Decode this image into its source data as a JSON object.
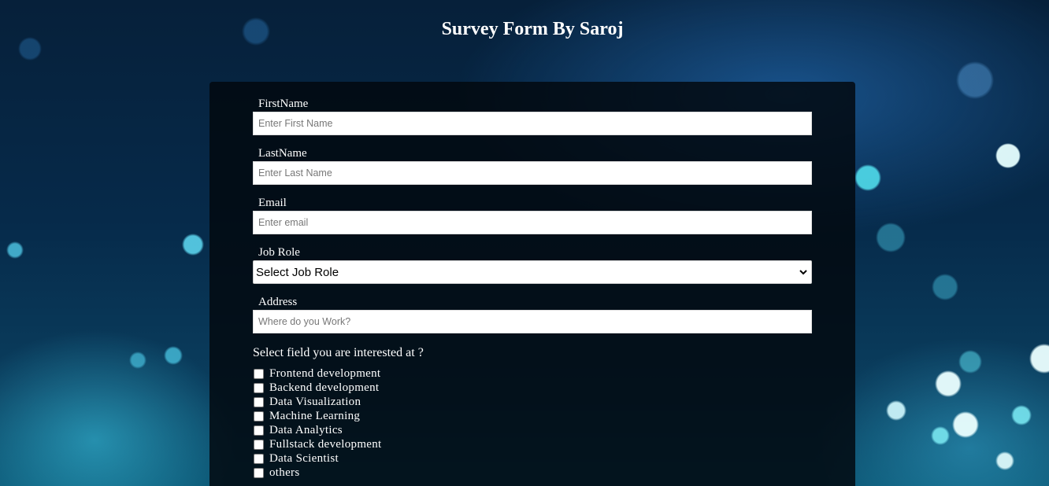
{
  "page": {
    "title": "Survey Form By Saroj"
  },
  "form": {
    "fields": [
      {
        "label": "FirstName",
        "placeholder": "Enter First Name",
        "value": ""
      },
      {
        "label": "LastName",
        "placeholder": "Enter Last Name",
        "value": ""
      },
      {
        "label": "Email",
        "placeholder": "Enter email",
        "value": ""
      }
    ],
    "job_role": {
      "label": "Job Role",
      "selected": "Select Job Role"
    },
    "address": {
      "label": "Address",
      "placeholder": "Where do you Work?",
      "value": ""
    },
    "interests": {
      "question": "Select field you are interested at ?",
      "options": [
        {
          "label": "Frontend development",
          "checked": false
        },
        {
          "label": "Backend development",
          "checked": false
        },
        {
          "label": "Data Visualization",
          "checked": false
        },
        {
          "label": "Machine Learning",
          "checked": false
        },
        {
          "label": "Data Analytics",
          "checked": false
        },
        {
          "label": "Fullstack development",
          "checked": false
        },
        {
          "label": "Data Scientist",
          "checked": false
        },
        {
          "label": "others",
          "checked": false
        }
      ]
    }
  },
  "colors": {
    "card_background": "#02080e",
    "text": "#ffffff",
    "input_background": "#ffffff"
  },
  "icons": {
    "select_arrow": "chevron-down-icon"
  }
}
